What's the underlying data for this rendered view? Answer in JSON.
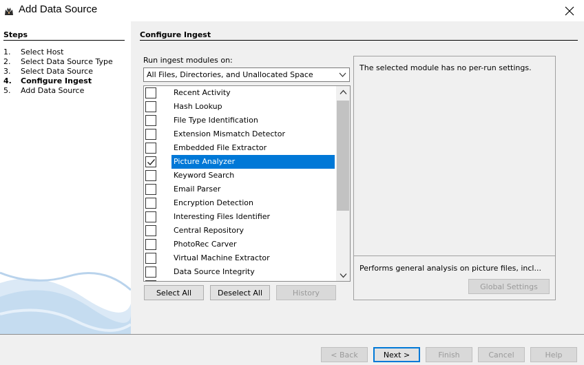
{
  "window": {
    "title": "Add Data Source",
    "app_icon": "autopsy-dog-icon",
    "close_icon": "close-icon"
  },
  "steps": {
    "title": "Steps",
    "items": [
      {
        "num": "1.",
        "label": "Select Host"
      },
      {
        "num": "2.",
        "label": "Select Data Source Type"
      },
      {
        "num": "3.",
        "label": "Select Data Source"
      },
      {
        "num": "4.",
        "label": "Configure Ingest"
      },
      {
        "num": "5.",
        "label": "Add Data Source"
      }
    ],
    "active_index": 3
  },
  "configure": {
    "title": "Configure Ingest",
    "run_label": "Run ingest modules on:",
    "run_value": "All Files, Directories, and Unallocated Space"
  },
  "modules": [
    {
      "label": "Recent Activity",
      "checked": false,
      "selected": false
    },
    {
      "label": "Hash Lookup",
      "checked": false,
      "selected": false
    },
    {
      "label": "File Type Identification",
      "checked": false,
      "selected": false
    },
    {
      "label": "Extension Mismatch Detector",
      "checked": false,
      "selected": false
    },
    {
      "label": "Embedded File Extractor",
      "checked": false,
      "selected": false
    },
    {
      "label": "Picture Analyzer",
      "checked": true,
      "selected": true
    },
    {
      "label": "Keyword Search",
      "checked": false,
      "selected": false
    },
    {
      "label": "Email Parser",
      "checked": false,
      "selected": false
    },
    {
      "label": "Encryption Detection",
      "checked": false,
      "selected": false
    },
    {
      "label": "Interesting Files Identifier",
      "checked": false,
      "selected": false
    },
    {
      "label": "Central Repository",
      "checked": false,
      "selected": false
    },
    {
      "label": "PhotoRec Carver",
      "checked": false,
      "selected": false
    },
    {
      "label": "Virtual Machine Extractor",
      "checked": false,
      "selected": false
    },
    {
      "label": "Data Source Integrity",
      "checked": false,
      "selected": false
    }
  ],
  "list_buttons": {
    "select_all": "Select All",
    "deselect_all": "Deselect All",
    "history": "History"
  },
  "settings": {
    "message": "The selected module has no per-run settings.",
    "description": "Performs general analysis on picture files, incl...",
    "global_settings": "Global Settings"
  },
  "nav": {
    "back": "< Back",
    "next": "Next >",
    "finish": "Finish",
    "cancel": "Cancel",
    "help": "Help"
  },
  "colors": {
    "selection": "#0078d7",
    "panel_bg": "#f0f0f0"
  }
}
